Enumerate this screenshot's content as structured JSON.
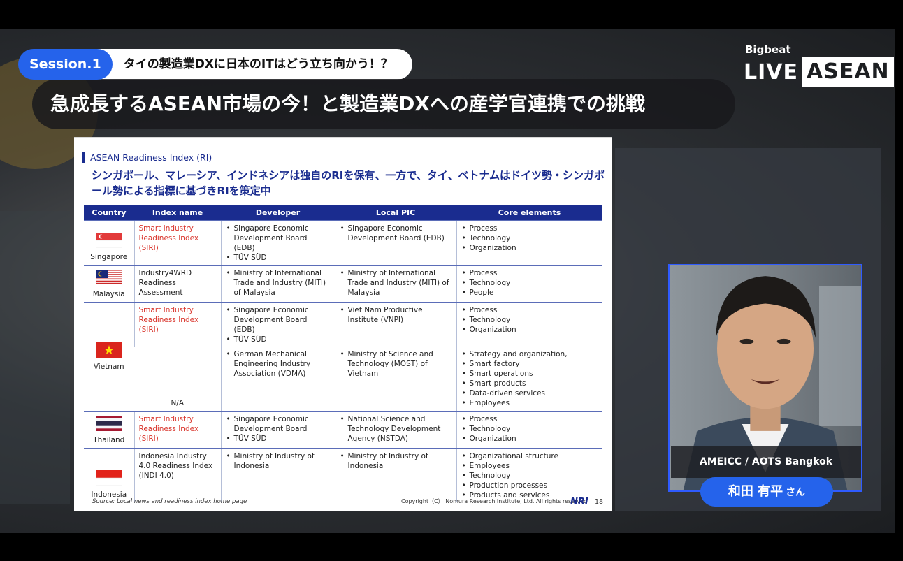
{
  "header": {
    "session_label": "Session.1",
    "session_subtitle": "タイの製造業DXに日本のITはどう立ち向かう！？",
    "title": "急成長するASEAN市場の今！と製造業DXへの産学官連携での挑戦"
  },
  "logo": {
    "top": "Bigbeat",
    "live": "LIVE",
    "asean": "ASEAN"
  },
  "slide": {
    "kicker": "ASEAN Readiness Index (RI)",
    "headline": "シンガポール、マレーシア、インドネシアは独自のRIを保有、一方で、タイ、ベトナムはドイツ勢・シンガポール勢による指標に基づきRIを策定中",
    "columns": [
      "Country",
      "Index name",
      "Developer",
      "Local PIC",
      "Core elements"
    ],
    "rows": [
      {
        "country": "Singapore",
        "flag": "singapore",
        "index": "Smart Industry Readiness Index (SIRI)",
        "index_red": true,
        "developer": [
          "Singapore Economic Development Board (EDB)",
          "TÜV SÜD"
        ],
        "pic": [
          "Singapore Economic Development Board (EDB)"
        ],
        "core": [
          "Process",
          "Technology",
          "Organization"
        ]
      },
      {
        "country": "Malaysia",
        "flag": "malaysia",
        "index": "Industry4WRD Readiness Assessment",
        "index_red": false,
        "developer": [
          "Ministry of International Trade and Industry (MITI) of Malaysia"
        ],
        "pic": [
          "Ministry of International Trade and Industry (MITI) of Malaysia"
        ],
        "core": [
          "Process",
          "Technology",
          "People"
        ]
      },
      {
        "country": "Vietnam",
        "flag": "vietnam",
        "index": "Smart Industry Readiness Index (SIRI)",
        "index_red": true,
        "developer": [
          "Singapore Economic Development Board (EDB)",
          "TÜV SÜD"
        ],
        "pic": [
          "Viet Nam Productive Institute (VNPI)"
        ],
        "core": [
          "Process",
          "Technology",
          "Organization"
        ]
      },
      {
        "country": "",
        "flag": "",
        "index": "N/A",
        "index_red": false,
        "developer": [
          "German Mechanical Engineering Industry Association (VDMA)"
        ],
        "pic": [
          "Ministry of Science and Technology (MOST) of Vietnam"
        ],
        "core": [
          "Strategy and organization,",
          "Smart factory",
          "Smart operations",
          "Smart products",
          "Data-driven services",
          "Employees"
        ]
      },
      {
        "country": "Thailand",
        "flag": "thailand",
        "index": "Smart Industry Readiness Index (SIRI)",
        "index_red": true,
        "developer": [
          "Singapore Economic Development Board",
          "TÜV SÜD"
        ],
        "pic": [
          "National Science and Technology Development Agency (NSTDA)"
        ],
        "core": [
          "Process",
          "Technology",
          "Organization"
        ]
      },
      {
        "country": "Indonesia",
        "flag": "indonesia",
        "index": "Indonesia Industry 4.0 Readiness Index (INDI 4.0)",
        "index_red": false,
        "developer": [
          "Ministry of Industry of Indonesia"
        ],
        "pic": [
          "Ministry of Industry of Indonesia"
        ],
        "core": [
          "Organizational structure",
          "Employees",
          "Technology",
          "Production processes",
          "Products and services"
        ]
      }
    ],
    "source": "Source: Local news and readiness index home page",
    "copyright": "Copyright（C） Nomura Research Institute, Ltd. All rights reserved.",
    "brand": "NRI",
    "page": "18"
  },
  "speaker": {
    "org": "AMEICC / AOTS Bangkok",
    "name": "和田 有平",
    "honorific": "さん"
  },
  "colors": {
    "accent": "#2563eb",
    "slide_navy": "#1a2c8f",
    "siri_red": "#d9342b"
  }
}
